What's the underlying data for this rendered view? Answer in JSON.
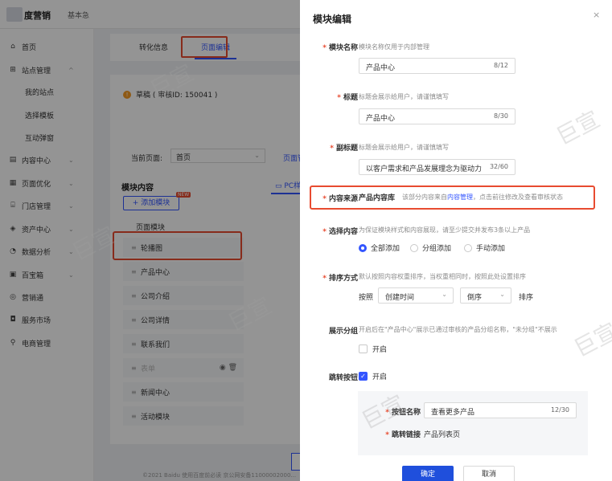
{
  "app": {
    "logo_text": "度营销",
    "edition": "基本急"
  },
  "sidebar": {
    "items": [
      {
        "icon": "home-icon",
        "glyph": "⌂",
        "label": "首页",
        "chev": ""
      },
      {
        "icon": "grid-icon",
        "glyph": "⊞",
        "label": "站点管理",
        "chev": "^"
      },
      {
        "icon": "",
        "glyph": "",
        "label": "我的站点",
        "chev": ""
      },
      {
        "icon": "",
        "glyph": "",
        "label": "选择模板",
        "chev": ""
      },
      {
        "icon": "",
        "glyph": "",
        "label": "互动弹窗",
        "chev": ""
      },
      {
        "icon": "content-icon",
        "glyph": "▤",
        "label": "内容中心",
        "chev": "⌄"
      },
      {
        "icon": "page-optimize-icon",
        "glyph": "▦",
        "label": "页面优化",
        "chev": "⌄"
      },
      {
        "icon": "store-icon",
        "glyph": "⌸",
        "label": "门店管理",
        "chev": "⌄"
      },
      {
        "icon": "asset-icon",
        "glyph": "◈",
        "label": "资产中心",
        "chev": "⌄"
      },
      {
        "icon": "analytics-icon",
        "glyph": "◔",
        "label": "数据分析",
        "chev": "⌄"
      },
      {
        "icon": "toolbox-icon",
        "glyph": "▣",
        "label": "百宝箱",
        "chev": "⌄"
      },
      {
        "icon": "marketing-icon",
        "glyph": "◎",
        "label": "营销通",
        "chev": ""
      },
      {
        "icon": "service-market-icon",
        "glyph": "◘",
        "label": "服务市场",
        "chev": ""
      },
      {
        "icon": "ecommerce-icon",
        "glyph": "⚲",
        "label": "电商管理",
        "chev": ""
      }
    ]
  },
  "background": {
    "tabs": [
      "转化信息",
      "页面编辑"
    ],
    "draft_status": "草稿 ( 审核ID: 150041 )",
    "current_page_label": "当前页面:",
    "current_page_value": "首页",
    "page_manage": "页面管理",
    "module_content_title": "模块内容",
    "pc_tab": "PC样...",
    "add_module": "+ 添加模块",
    "new_badge": "NEW",
    "page_module_header": "页面模块",
    "modules": [
      {
        "label": "轮播图",
        "disabled": false
      },
      {
        "label": "产品中心",
        "disabled": false
      },
      {
        "label": "公司介绍",
        "disabled": false
      },
      {
        "label": "公司详情",
        "disabled": false
      },
      {
        "label": "联系我们",
        "disabled": false
      },
      {
        "label": "表单",
        "disabled": true
      },
      {
        "label": "新闻中心",
        "disabled": false
      },
      {
        "label": "活动模块",
        "disabled": false
      }
    ],
    "save_button": "保",
    "footer": "©2021 Baidu 使用百度前必读 京公网安备11000002000..."
  },
  "drawer": {
    "title": "模块编辑",
    "close": "×",
    "module_name": {
      "label": "模块名称",
      "hint": "模块名称仅用于内部管理",
      "value": "产品中心",
      "count": "8/12"
    },
    "title_field": {
      "label": "标题",
      "hint": "标题会展示给用户，请谨慎填写",
      "value": "产品中心",
      "count": "8/30"
    },
    "subtitle_field": {
      "label": "副标题",
      "hint": "标题会展示给用户，请谨慎填写",
      "value": "以客户需求和产品发展理念为驱动力",
      "count": "32/60"
    },
    "content_source": {
      "label": "内容来源",
      "value": "产品内容库",
      "hint_before": "该部分内容来自",
      "hint_link": "内容管理",
      "hint_after": "，点击前往修改及查看审核状态"
    },
    "select_content": {
      "label": "选择内容",
      "hint": "为保证模块样式和内容展现，请至少提交并发布3条以上产品",
      "options": [
        {
          "label": "全部添加",
          "checked": true
        },
        {
          "label": "分组添加",
          "checked": false
        },
        {
          "label": "手动添加",
          "checked": false
        }
      ]
    },
    "sort": {
      "label": "排序方式",
      "hint": "默认按照内容权重排序，当权重相同时，按照此处设置排序",
      "prefix": "按照",
      "field": "创建时间",
      "order": "倒序",
      "suffix": "排序"
    },
    "group_display": {
      "label": "展示分组",
      "hint": "开启后在\"产品中心\"展示已通过审核的产品分组名称，\"未分组\"不展示",
      "toggle_label": "开启",
      "checked": false
    },
    "jump_button": {
      "label": "跳转按钮",
      "toggle_label": "开启",
      "checked": true,
      "name_label": "按钮名称",
      "name_value": "查看更多产品",
      "name_count": "12/30",
      "link_label": "跳转链接",
      "link_value": "产品列表页"
    },
    "ok_button": "确定",
    "cancel_button": "取消"
  },
  "watermark": "巨宣",
  "colors": {
    "primary": "#3355ff",
    "confirm": "#1f4fdc",
    "highlight": "#e84b30",
    "required": "#e84b30"
  }
}
